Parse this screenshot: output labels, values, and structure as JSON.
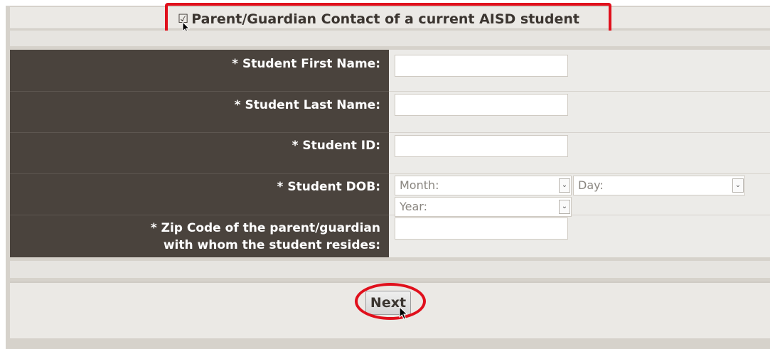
{
  "header": {
    "checkbox_glyph": "☑",
    "title": "Parent/Guardian Contact of a current AISD student"
  },
  "form": {
    "first_name_label": "* Student First Name:",
    "last_name_label": "* Student Last Name:",
    "student_id_label": "* Student ID:",
    "dob_label": "* Student DOB:",
    "zip_label_line1": "* Zip Code of the parent/guardian",
    "zip_label_line2": "with whom the student resides:",
    "first_name_value": "",
    "last_name_value": "",
    "student_id_value": "",
    "zip_value": "",
    "dob_month": "Month:",
    "dob_day": "Day:",
    "dob_year": "Year:"
  },
  "footer": {
    "next_label": "Next"
  },
  "colors": {
    "label_background": "#4a433d",
    "highlight": "#e0101c"
  },
  "icons": [
    "checkbox-checked-icon",
    "cursor-icon",
    "chevron-down-icon"
  ]
}
